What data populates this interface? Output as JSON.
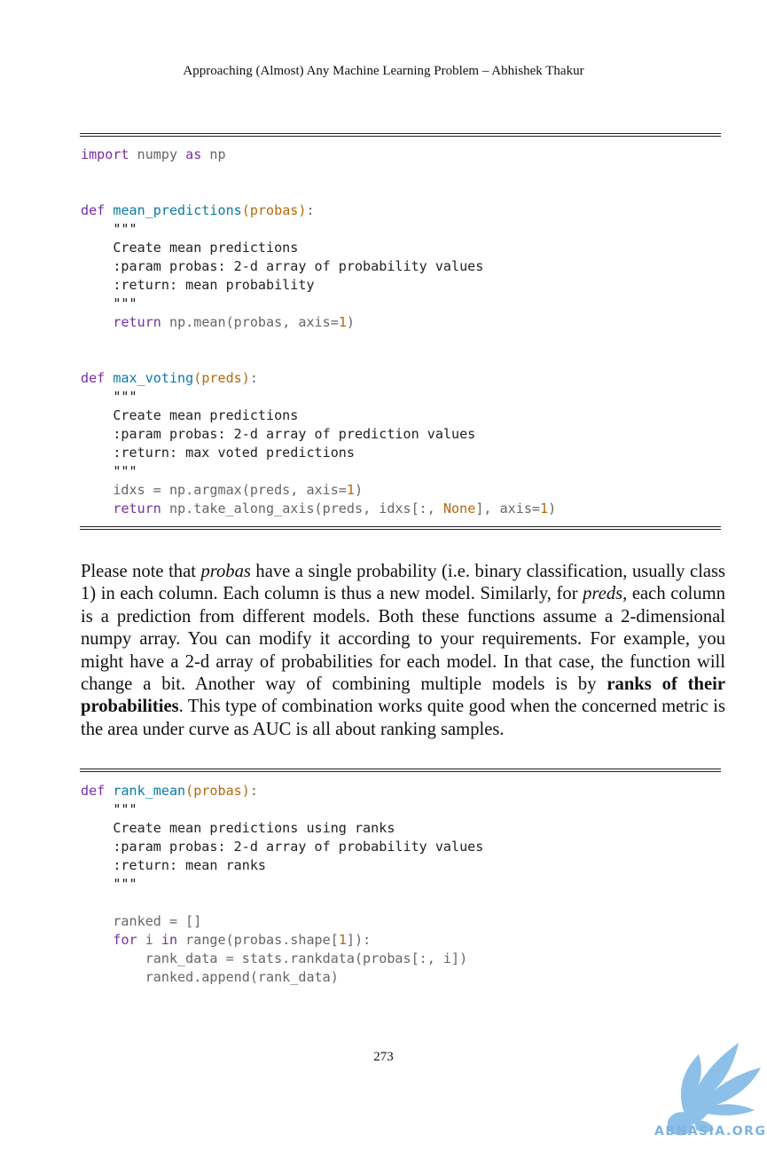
{
  "header": {
    "title": "Approaching (Almost) Any Machine Learning Problem – Abhishek Thakur"
  },
  "code1": {
    "l1_kw1": "import",
    "l1_t1": " numpy ",
    "l1_kw2": "as",
    "l1_t2": " np",
    "l2_def": "def",
    "l2_fn": "mean_predictions",
    "l2_p": "(probas)",
    "l2_c": ":",
    "l3": "    \"\"\"",
    "l4": "    Create mean predictions",
    "l5": "    :param probas: 2-d array of probability values",
    "l6": "    :return: mean probability",
    "l7": "    \"\"\"",
    "l8_ind": "    ",
    "l8_kw": "return",
    "l8_t": " np.mean(probas, axis=",
    "l8_n": "1",
    "l8_e": ")",
    "l9_def": "def",
    "l9_fn": "max_voting",
    "l9_p": "(preds)",
    "l9_c": ":",
    "l10": "    \"\"\"",
    "l11": "    Create mean predictions",
    "l12": "    :param probas: 2-d array of prediction values",
    "l13": "    :return: max voted predictions",
    "l14": "    \"\"\"",
    "l15_t": "    idxs = np.argmax(preds, axis=",
    "l15_n": "1",
    "l15_e": ")",
    "l16_ind": "    ",
    "l16_kw": "return",
    "l16_t": " np.take_along_axis(preds, idxs[:, ",
    "l16_none": "None",
    "l16_t2": "], axis=",
    "l16_n": "1",
    "l16_e": ")"
  },
  "paragraph": {
    "s1": "Please note that ",
    "probas": "probas",
    "s2": " have a single probability (i.e. binary classification, usually class 1) in each column. Each column is thus a new model. Similarly, for ",
    "preds": "preds",
    "s3": ", each column is a prediction from different models. Both these functions assume a 2-dimensional numpy array. You can modify it according to your requirements. For example, you might have a 2-d array of probabilities for each model. In that case, the function will change a bit.  Another way of combining multiple models is by ",
    "bold": "ranks of their probabilities",
    "s4": ". This type of combination works quite good when the concerned metric is the area under curve as AUC is all about ranking samples."
  },
  "code2": {
    "l1_def": "def",
    "l1_fn": "rank_mean",
    "l1_p": "(probas)",
    "l1_c": ":",
    "l2": "    \"\"\"",
    "l3": "    Create mean predictions using ranks",
    "l4": "    :param probas: 2-d array of probability values",
    "l5": "    :return: mean ranks",
    "l6": "    \"\"\"",
    "l7": "    ranked = []",
    "l8_ind": "    ",
    "l8_kw1": "for",
    "l8_t1": " i ",
    "l8_kw2": "in",
    "l8_t2": " range(probas.shape[",
    "l8_n": "1",
    "l8_e": "]):",
    "l9": "        rank_data = stats.rankdata(probas[:, i])",
    "l10": "        ranked.append(rank_data)"
  },
  "page_number": "273",
  "watermark": {
    "text": "ABNASIA.ORG",
    "color": "#7fb3e0"
  }
}
